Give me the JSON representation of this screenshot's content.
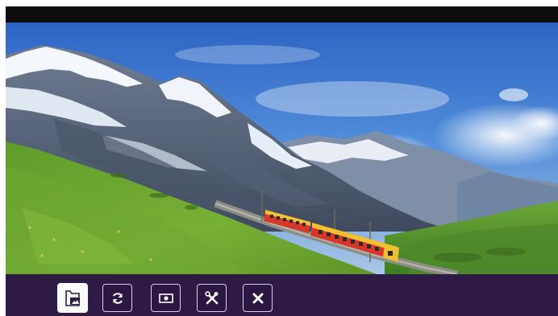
{
  "viewer": {
    "image": {
      "subject": "mountain-railway-landscape"
    },
    "colors": {
      "toolbar_bg": "#2d1b46",
      "top_bar_bg": "#0e0e10",
      "button_border": "#d8cfe6",
      "active_button_bg": "#fafafa"
    }
  },
  "toolbar": {
    "buttons": [
      {
        "icon": "folder-image-icon",
        "state": "active"
      },
      {
        "icon": "rotate-icon",
        "state": "normal"
      },
      {
        "icon": "slideshow-icon",
        "state": "normal"
      },
      {
        "icon": "tools-icon",
        "state": "normal"
      },
      {
        "icon": "close-icon",
        "state": "normal"
      }
    ]
  }
}
